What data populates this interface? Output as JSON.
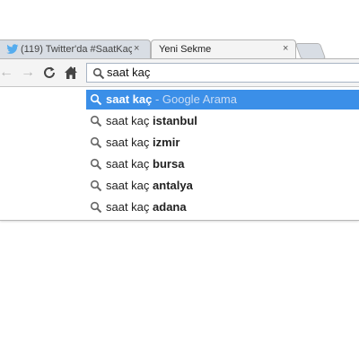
{
  "tabs": [
    {
      "title": "(119) Twitter'da #SaatKaç",
      "active": false,
      "icon": "twitter-bird-icon"
    },
    {
      "title": "Yeni Sekme",
      "active": true
    }
  ],
  "tab_close_glyph": "×",
  "toolbar": {
    "back_glyph": "←",
    "forward_glyph": "→",
    "reload_glyph": "C",
    "home_glyph": "⌂"
  },
  "omnibox": {
    "value": "saat kaç",
    "icon": "search-icon"
  },
  "suggestions": [
    {
      "typed": "saat kaç",
      "completion": "",
      "hint": " - Google Arama",
      "selected": true
    },
    {
      "typed": "saat kaç ",
      "completion": "istanbul",
      "hint": "",
      "selected": false
    },
    {
      "typed": "saat kaç ",
      "completion": "izmir",
      "hint": "",
      "selected": false
    },
    {
      "typed": "saat kaç ",
      "completion": "bursa",
      "hint": "",
      "selected": false
    },
    {
      "typed": "saat kaç ",
      "completion": "antalya",
      "hint": "",
      "selected": false
    },
    {
      "typed": "saat kaç ",
      "completion": "adana",
      "hint": "",
      "selected": false
    }
  ],
  "colors": {
    "selection": "#3b8fe8",
    "twitter_blue": "#55acee"
  }
}
